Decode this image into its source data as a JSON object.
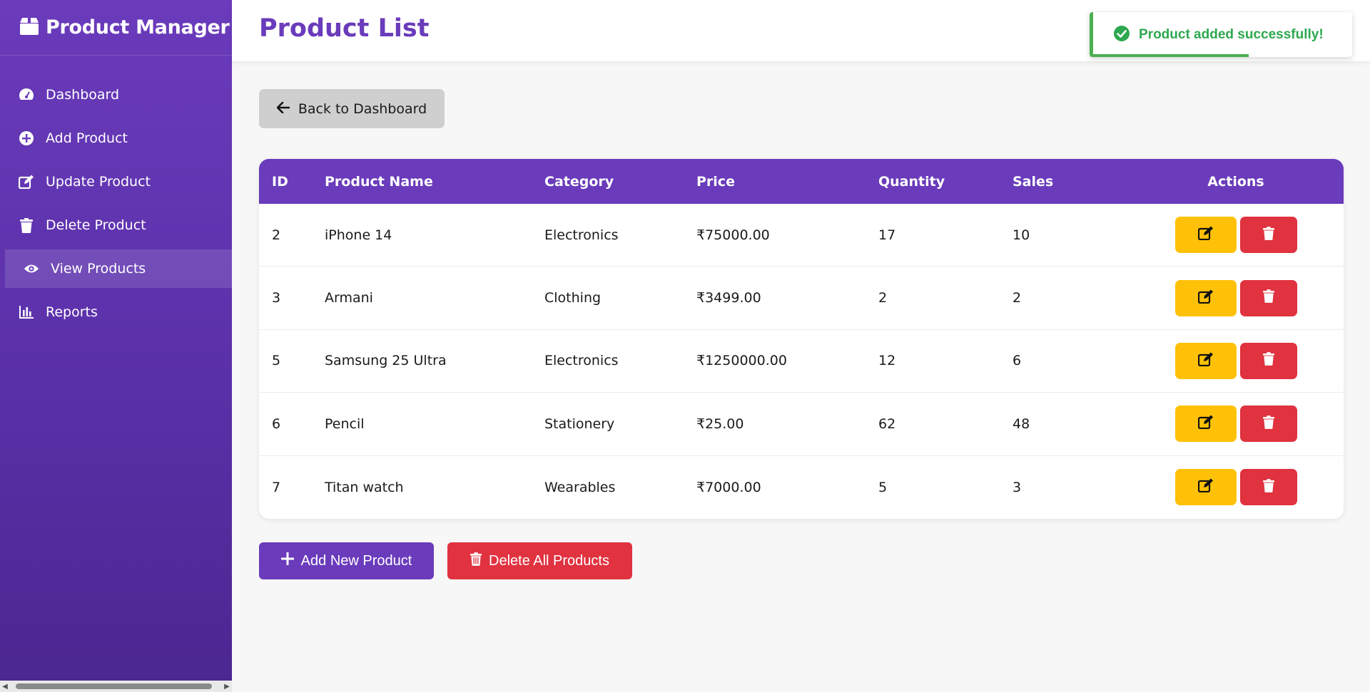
{
  "app": {
    "brand_title": "Product Manager",
    "brand_icon": "box-icon"
  },
  "sidebar": {
    "items": [
      {
        "label": "Dashboard",
        "icon": "gauge-icon",
        "active": false
      },
      {
        "label": "Add Product",
        "icon": "plus-circle-icon",
        "active": false
      },
      {
        "label": "Update Product",
        "icon": "edit-icon",
        "active": false
      },
      {
        "label": "Delete Product",
        "icon": "trash-icon",
        "active": false
      },
      {
        "label": "View Products",
        "icon": "eye-icon",
        "active": true
      },
      {
        "label": "Reports",
        "icon": "bar-chart-icon",
        "active": false
      }
    ]
  },
  "header": {
    "title": "Product List"
  },
  "toast": {
    "message": "Product added successfully!",
    "progress": 0.6
  },
  "back_button": {
    "label": "Back to Dashboard"
  },
  "table": {
    "columns": [
      "ID",
      "Product Name",
      "Category",
      "Price",
      "Quantity",
      "Sales",
      "Actions"
    ],
    "rows": [
      {
        "id": "2",
        "name": "iPhone 14",
        "category": "Electronics",
        "price": "₹75000.00",
        "quantity": "17",
        "sales": "10"
      },
      {
        "id": "3",
        "name": "Armani",
        "category": "Clothing",
        "price": "₹3499.00",
        "quantity": "2",
        "sales": "2"
      },
      {
        "id": "5",
        "name": "Samsung 25 Ultra",
        "category": "Electronics",
        "price": "₹1250000.00",
        "quantity": "12",
        "sales": "6"
      },
      {
        "id": "6",
        "name": "Pencil",
        "category": "Stationery",
        "price": "₹25.00",
        "quantity": "62",
        "sales": "48"
      },
      {
        "id": "7",
        "name": "Titan watch",
        "category": "Wearables",
        "price": "₹7000.00",
        "quantity": "5",
        "sales": "3"
      }
    ]
  },
  "actions": {
    "add_label": "Add New Product",
    "delete_all_label": "Delete All Products"
  },
  "colors": {
    "primary": "#6a3bbb",
    "warning": "#ffc107",
    "danger": "#e0323f",
    "success": "#4caf50"
  }
}
